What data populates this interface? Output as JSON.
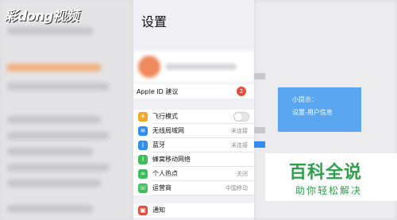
{
  "watermark": {
    "logo_text": "彩dong视频"
  },
  "settings": {
    "title": "设置",
    "apple_id": {
      "label": "Apple ID 建议",
      "badge": "2"
    },
    "rows": [
      {
        "label": "飞行模式",
        "value": "",
        "icon": "airplane-icon",
        "icon_color": "#f5a623",
        "glyph": "✈"
      },
      {
        "label": "无线局域网",
        "value": "未连接",
        "icon": "wifi-icon",
        "icon_color": "#2f8cf2",
        "glyph": "≋"
      },
      {
        "label": "蓝牙",
        "value": "未连接",
        "icon": "bluetooth-icon",
        "icon_color": "#2f8cf2",
        "glyph": "ᛒ"
      },
      {
        "label": "蜂窝移动网络",
        "value": "",
        "icon": "cellular-icon",
        "icon_color": "#3dbe5a",
        "glyph": "⌇"
      },
      {
        "label": "个人热点",
        "value": "关闭",
        "icon": "hotspot-icon",
        "icon_color": "#3dbe5a",
        "glyph": "∞"
      },
      {
        "label": "运营商",
        "value": "中国移动",
        "icon": "carrier-icon",
        "icon_color": "#3dbe5a",
        "glyph": "☏"
      }
    ],
    "notification": {
      "label": "通知",
      "icon": "notification-icon",
      "icon_color": "#e74c3c",
      "glyph": "▣"
    }
  },
  "tip": {
    "title": "小提示：",
    "text": "设置-用户信息"
  },
  "brand": {
    "title": "百科全说",
    "subtitle": "助你轻松解决"
  }
}
